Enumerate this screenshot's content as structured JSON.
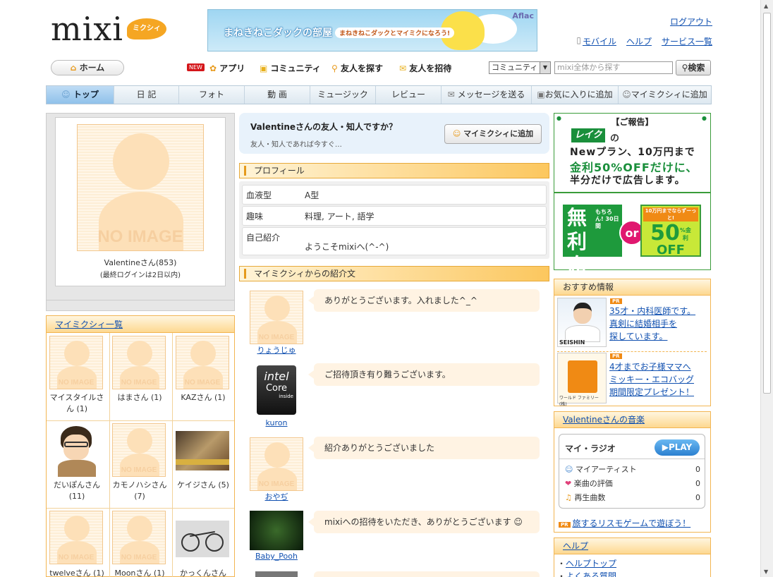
{
  "header": {
    "logo_text": "mixi",
    "logo_badge": "ミクシィ",
    "banner_text": "まねきねこダックの部屋",
    "banner_sub": "まねきねこダックとマイミクになろう!",
    "banner_brand": "Aflac",
    "logout": "ログアウト",
    "links": [
      "モバイル",
      "ヘルプ",
      "サービス一覧"
    ]
  },
  "nav": {
    "home": "ホーム",
    "new_badge": "NEW",
    "app": "アプリ",
    "community": "コミュニティ",
    "find_friends": "友人を探す",
    "invite": "友人を招待",
    "search_scope": "コミュニティ",
    "search_placeholder": "mixi全体から探す",
    "search_btn": "検索"
  },
  "tabs": [
    "トップ",
    "日 記",
    "フォト",
    "動 画",
    "ミュージック",
    "レビュー",
    "メッセージを送る",
    "お気に入りに追加",
    "マイミクシィに追加"
  ],
  "profile": {
    "noimage": "NO IMAGE",
    "name": "Valentineさん(853)",
    "login": "(最終ログインは2日以内)"
  },
  "friends": {
    "title": "マイミクシィ一覧",
    "items": [
      {
        "name": "マイスタイルさん (1)"
      },
      {
        "name": "はまさん (1)"
      },
      {
        "name": "KAZさん (1)"
      },
      {
        "name": "だいぽんさん (11)"
      },
      {
        "name": "カモノハシさん (7)"
      },
      {
        "name": "ケイジさん (5)"
      },
      {
        "name": "twelveさん (1)"
      },
      {
        "name": "Moonさん (1)"
      },
      {
        "name": "かっくんさん"
      }
    ],
    "noimage": "NO IMAGE"
  },
  "friend_question": {
    "title": "Valentineさんの友人・知人ですか？",
    "sub": "友人・知人であれば今すぐ…",
    "button": "マイミクシィに追加"
  },
  "profile_section": {
    "title": "プロフィール",
    "rows": [
      {
        "k": "血液型",
        "v": "A型"
      },
      {
        "k": "趣味",
        "v": "料理, アート, 語学"
      },
      {
        "k": "自己紹介",
        "v": "ようこそmixiへ(^-^)"
      }
    ]
  },
  "intro_section": {
    "title": "マイミクシィからの紹介文",
    "items": [
      {
        "name": "りょうじゅ",
        "text": "ありがとうございます。入れました^_^"
      },
      {
        "name": "kuron",
        "text": "ご招待頂き有り難うございます。"
      },
      {
        "name": "おやぢ",
        "text": "紹介ありがとうございました"
      },
      {
        "name": "Baby_Pooh",
        "text": "mixiへの招待をいただき、ありがとうございます ☺"
      }
    ],
    "intel_line1": "intel",
    "intel_line2": "Core",
    "intel_line3": "inside"
  },
  "ad": {
    "report": "【ご報告】",
    "logo": "レイク",
    "no": "の",
    "line2": "Newプラン、10万円まで",
    "line3": "金利50%OFFだけに、",
    "line4": "半分だけで広告します。",
    "muri": "無利息",
    "muri_sub": "もちろん! 30日間",
    "or": "or",
    "off_top": "10万円までならずーっと!",
    "off_num": "50",
    "off_unit": "%金利",
    "off": "OFF"
  },
  "recommend": {
    "title": "おすすめ情報",
    "pr": "PR",
    "item1": [
      "35才・内科医師です。",
      "真剣に結婚相手を",
      "探しています。"
    ],
    "item1_brand": "SEISHIN",
    "item2": [
      "4才までお子様ママへ",
      "ミッキー・エコバッグ",
      "期間限定プレゼント！"
    ],
    "item2_brand": "ワールド ファミリー(株)"
  },
  "music": {
    "title": "Valentineさんの音楽",
    "radio": "マイ・ラジオ",
    "play": "▶PLAY",
    "rows": [
      {
        "label": "マイアーティスト",
        "n": "0"
      },
      {
        "label": "楽曲の評価",
        "n": "0"
      },
      {
        "label": "再生曲数",
        "n": "0"
      }
    ],
    "pr_link": "旅するリスモゲームで遊ぼう！"
  },
  "help": {
    "title": "ヘルプ",
    "links": [
      "ヘルプトップ",
      "よくある質問"
    ]
  }
}
